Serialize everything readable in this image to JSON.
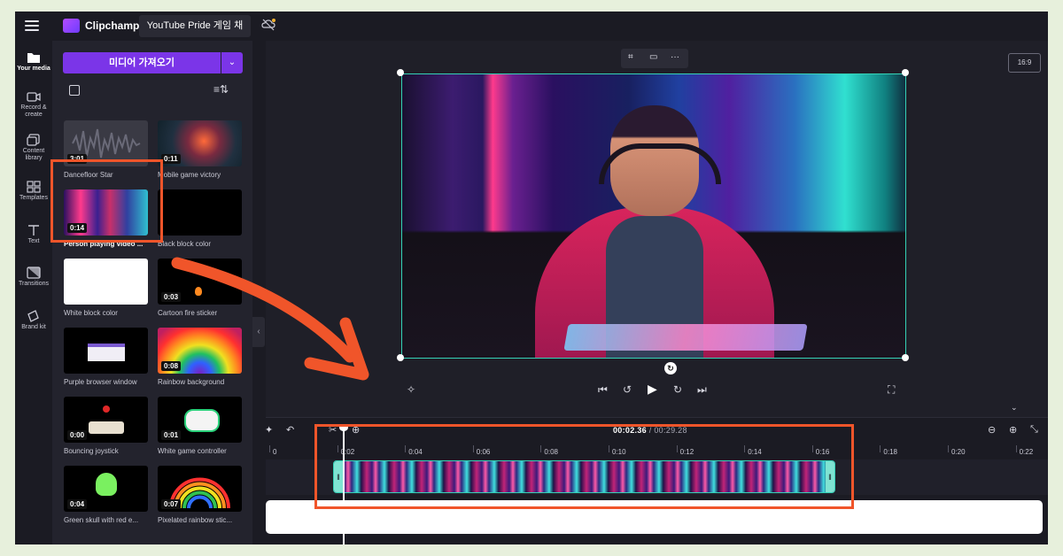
{
  "app": {
    "brand": "Clipchamp",
    "project_tab": "YouTube Pride 게임 채"
  },
  "rail": [
    {
      "label": "Your media",
      "icon": "folder-icon",
      "active": true
    },
    {
      "label": "Record & create",
      "icon": "camera-icon"
    },
    {
      "label": "Content library",
      "icon": "library-icon"
    },
    {
      "label": "Templates",
      "icon": "templates-icon"
    },
    {
      "label": "Text",
      "icon": "text-icon"
    },
    {
      "label": "Transitions",
      "icon": "transitions-icon"
    },
    {
      "label": "Brand kit",
      "icon": "brand-kit-icon"
    }
  ],
  "media": {
    "import_label": "미디어 가져오기",
    "items": [
      {
        "name": "Dancefloor Star",
        "duration": "3:01"
      },
      {
        "name": "Mobile game victory",
        "duration": "0:11"
      },
      {
        "name": "Person playing video ...",
        "duration": "0:14"
      },
      {
        "name": "Black block color",
        "duration": ""
      },
      {
        "name": "White block color",
        "duration": ""
      },
      {
        "name": "Cartoon fire sticker",
        "duration": "0:03"
      },
      {
        "name": "Purple browser window",
        "duration": ""
      },
      {
        "name": "Rainbow background",
        "duration": "0:08"
      },
      {
        "name": "Bouncing joystick",
        "duration": "0:00"
      },
      {
        "name": "White game controller",
        "duration": "0:01"
      },
      {
        "name": "Green skull with red e...",
        "duration": "0:04"
      },
      {
        "name": "Pixelated rainbow stic...",
        "duration": "0:07"
      }
    ]
  },
  "preview": {
    "aspect_ratio": "16:9"
  },
  "timeline": {
    "current": "00:02.36",
    "total": "/ 00:29.28",
    "ticks": [
      "0",
      "0:02",
      "0:04",
      "0:06",
      "0:08",
      "0:10",
      "0:12",
      "0:14",
      "0:16",
      "0:18",
      "0:20",
      "0:22"
    ]
  },
  "colors": {
    "accent": "#7b35e8",
    "selection": "#34d1b6",
    "highlight": "#f0552a"
  }
}
